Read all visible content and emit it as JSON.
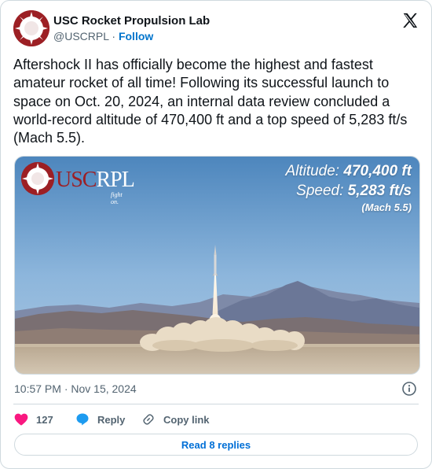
{
  "author": {
    "name": "USC Rocket Propulsion Lab",
    "handle": "@USCRPL",
    "separator": "·",
    "follow_label": "Follow"
  },
  "icons": {
    "avatar": "usc-rpl-logo",
    "brand": "x-logo-icon",
    "info": "info-icon",
    "like": "heart-icon",
    "reply": "reply-bubble-icon",
    "copy": "link-icon"
  },
  "tweet": {
    "text": "Aftershock II has officially become the highest and fastest amateur rocket of all time! Following its successful launch to space on Oct. 20, 2024, an internal data review concluded a world-record altitude of 470,400 ft and a top speed of 5,283 ft/s (Mach 5.5)."
  },
  "media": {
    "logo_usc": "USC",
    "logo_rpl": "RPL",
    "logo_tagline": "fight on.",
    "altitude_label": "Altitude:",
    "altitude_value": "470,400 ft",
    "speed_label": "Speed:",
    "speed_value": "5,283 ft/s",
    "mach": "(Mach 5.5)"
  },
  "meta": {
    "timestamp": "10:57 PM · Nov 15, 2024"
  },
  "actions": {
    "like_count": "127",
    "reply_label": "Reply",
    "copy_label": "Copy link"
  },
  "footer": {
    "read_replies": "Read 8 replies"
  },
  "colors": {
    "brand_red": "#9c1f24",
    "link_blue": "#006fd6",
    "like_pink": "#f91880",
    "reply_blue": "#1d9bf0"
  }
}
